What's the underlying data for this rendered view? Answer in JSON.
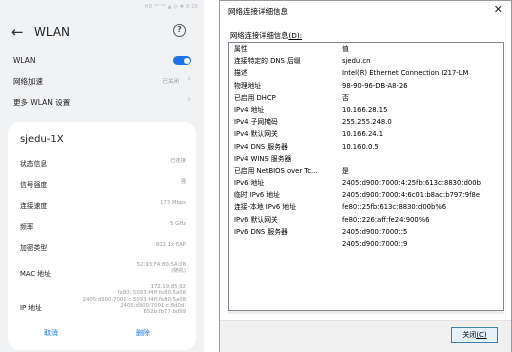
{
  "phone": {
    "status_text": "HD ⁴ᴳ ⁴ᴳ ▲ ◎ ✱ 8:26",
    "title": "WLAN",
    "back_icon": "←",
    "help_icon": "?",
    "rows": {
      "wlan_label": "WLAN",
      "accel_label": "网络加速",
      "accel_value": "已关闭",
      "more_label": "更多 WLAN 设置"
    },
    "chevron": "›",
    "accent_color": "#1a73e8",
    "network": {
      "ssid": "sjedu-1X",
      "status_label": "状态信息",
      "status_value": "已连接",
      "signal_label": "信号强度",
      "signal_value": "强",
      "speed_label": "连接速度",
      "speed_value": "173 Mbps",
      "freq_label": "频率",
      "freq_value": "5 GHz",
      "enc_label": "加密类型",
      "enc_value": "802.1x EAP",
      "mac_label": "MAC 地址",
      "mac_value_1": "52:93:F4:80:5A:08",
      "mac_value_2": "(随机)",
      "ip_label": "IP 地址",
      "ip_value_1": "172.19.85.92",
      "ip_value_2": "fe80::5093:f4ff:fe80:5a08",
      "ip_value_3": "2405:d900:7001:c:5093:f4ff:fe80:5a08",
      "ip_value_4": "2405:d900:7001:c:8d0d:",
      "ip_value_5": "652b:fb77:bd99",
      "cancel_label": "取消",
      "delete_label": "删除"
    }
  },
  "dialog": {
    "title": "网络连接详细信息",
    "close_icon": "✕",
    "heading": "网络连接详细信息",
    "heading_key": "(D):",
    "columns": [
      "属性",
      "值"
    ],
    "rows": [
      {
        "prop": "连接特定的 DNS 后缀",
        "value": "sjedu.cn"
      },
      {
        "prop": "描述",
        "value": "Intel(R) Ethernet Connection I217-LM"
      },
      {
        "prop": "物理地址",
        "value": "98-90-96-DB-A8-26"
      },
      {
        "prop": "已启用 DHCP",
        "value": "否"
      },
      {
        "prop": "IPv4 地址",
        "value": "10.166.28.15"
      },
      {
        "prop": "IPv4 子网掩码",
        "value": "255.255.248.0"
      },
      {
        "prop": "IPv4 默认网关",
        "value": "10.166.24.1"
      },
      {
        "prop": "IPv4 DNS 服务器",
        "value": "10.160.0.5"
      },
      {
        "prop": "IPv4 WINS 服务器",
        "value": ""
      },
      {
        "prop": "已启用 NetBIOS over Tc...",
        "value": "是"
      },
      {
        "prop": "IPv6 地址",
        "value": "2405:d900:7000:4:25fb:613c:8830:d00b"
      },
      {
        "prop": "临时 IPv6 地址",
        "value": "2405:d900:7000:4:6c01:b8ac:b797:9f8e"
      },
      {
        "prop": "连接-本地 IPv6 地址",
        "value": "fe80::25fb:613c:8830:d00b%6"
      },
      {
        "prop": "IPv6 默认网关",
        "value": "fe80::226:aff:fe24:900%6"
      },
      {
        "prop": "IPv6 DNS 服务器",
        "value": "2405:d900:7000::5"
      },
      {
        "prop": "",
        "value": "2405:d900:7000::9"
      }
    ],
    "close_button": "关闭",
    "close_button_key": "(C)"
  }
}
